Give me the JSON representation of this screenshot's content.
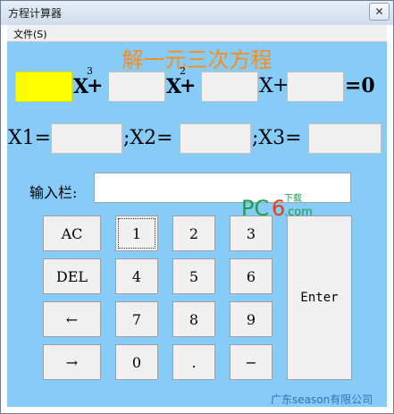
{
  "window": {
    "title": "方程计算器",
    "close_glyph": "✕",
    "menu_file": "文件(S)"
  },
  "equation": {
    "heading": "解一元三次方程",
    "x_term": "X",
    "plus": "+",
    "cube_exp": "3",
    "square_exp": "2",
    "equals_zero": "=0"
  },
  "roots": {
    "x1_label": "X1=",
    "x2_label": ";X2=",
    "x3_label": ";X3="
  },
  "input": {
    "label": "输入栏:"
  },
  "keypad": {
    "ac": "AC",
    "del": "DEL",
    "left_arrow": "←",
    "right_arrow": "→",
    "k1": "1",
    "k2": "2",
    "k3": "3",
    "k4": "4",
    "k5": "5",
    "k6": "6",
    "k7": "7",
    "k8": "8",
    "k9": "9",
    "k0": "0",
    "dot": ".",
    "minus": "−",
    "enter": "Enter"
  },
  "watermark": {
    "brand_pc": "PC",
    "brand_six": "6",
    "brand_cn": "下载",
    "brand_com": ".com"
  },
  "footer": "广东season有限公司",
  "colors": {
    "client_bg": "#87cbf8",
    "heading": "#ff8c19",
    "coef_a": "#ffff00",
    "footer": "#3070c0"
  }
}
